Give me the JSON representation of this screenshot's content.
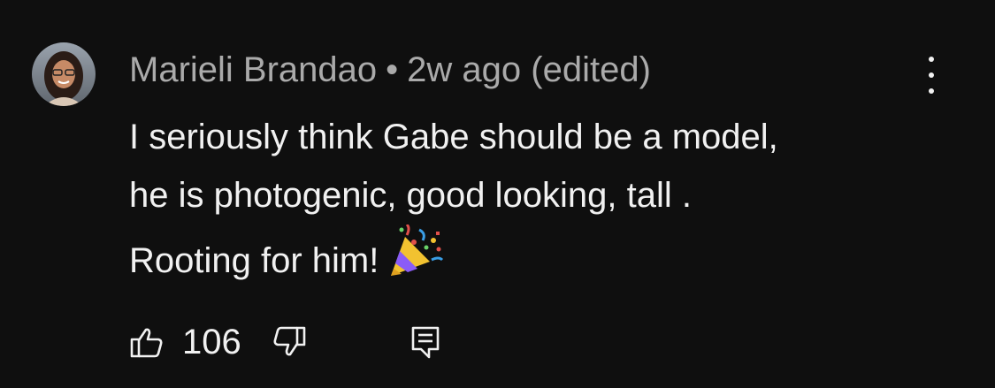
{
  "comment": {
    "author": "Marieli Brandao",
    "separator": "•",
    "time": "2w ago",
    "edited": "(edited)",
    "text_lines": [
      "I seriously think Gabe should be a model,",
      "he is photogenic, good looking, tall .",
      "Rooting for him!"
    ],
    "emoji": "party-popper"
  },
  "actions": {
    "like_count": "106",
    "like_icon": "thumbs-up-icon",
    "dislike_icon": "thumbs-down-icon",
    "reply_icon": "reply-comment-icon",
    "menu_icon": "more-vertical-icon"
  },
  "colors": {
    "background": "#0f0f0f",
    "text_primary": "#f1f1f1",
    "text_secondary": "#aaaaaa"
  }
}
